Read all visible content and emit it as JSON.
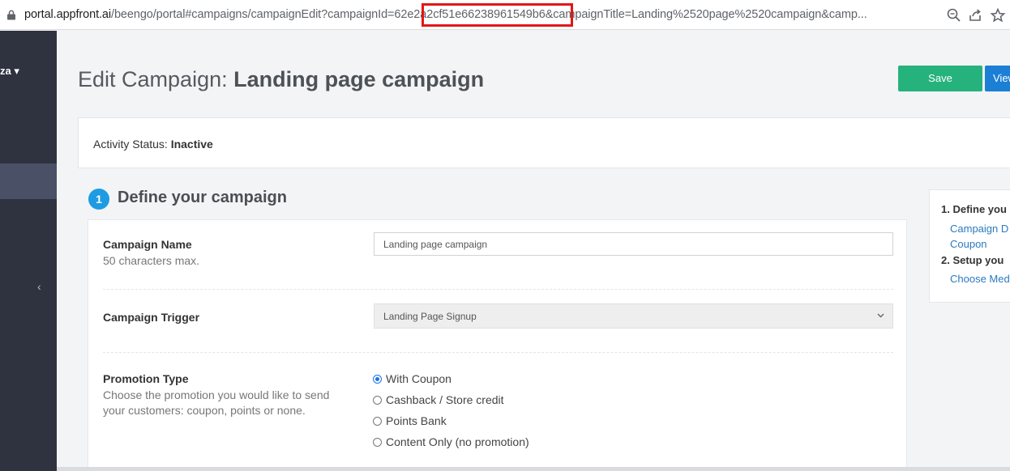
{
  "browser": {
    "url_host": "portal.appfront.ai",
    "url_rest": "/beengo/portal#campaigns/campaignEdit?campaignId=62e2a2cf51e66238961549b6&campaignTitle=Landing%2520page%2520campaign&camp..."
  },
  "sidebar": {
    "user_label": "za ▾",
    "collapse_icon": "‹"
  },
  "header": {
    "title_prefix": "Edit Campaign:",
    "title_name": "Landing page campaign",
    "save_label": "Save",
    "view_label": "View"
  },
  "status": {
    "label": "Activity Status:",
    "value": "Inactive"
  },
  "section": {
    "number": "1",
    "title": "Define your campaign"
  },
  "form": {
    "campaign_name": {
      "label": "Campaign Name",
      "hint": "50 characters max.",
      "value": "Landing page campaign"
    },
    "campaign_trigger": {
      "label": "Campaign Trigger",
      "selected": "Landing Page Signup"
    },
    "promotion_type": {
      "label": "Promotion Type",
      "hint": "Choose the promotion you would like to send your customers: coupon, points or none.",
      "options": [
        "With Coupon",
        "Cashback / Store credit",
        "Points Bank",
        "Content Only (no promotion)"
      ],
      "selected_index": 0
    }
  },
  "toc": {
    "items": [
      {
        "type": "section",
        "text": "1. Define you"
      },
      {
        "type": "link",
        "text": "Campaign D"
      },
      {
        "type": "link",
        "text": "Coupon"
      },
      {
        "type": "section",
        "text": "2. Setup you"
      },
      {
        "type": "link",
        "text": "Choose Med"
      }
    ]
  },
  "colors": {
    "save": "#26b27c",
    "view": "#1b7fd6",
    "badge": "#1e9be2",
    "sidebar": "#2f3340",
    "highlight": "#e01717"
  },
  "icons": [
    "lock-icon",
    "zoom-icon",
    "share-icon",
    "star-icon",
    "chevron-down-icon",
    "radio-checked-icon",
    "radio-unchecked-icon",
    "collapse-chevron-icon"
  ]
}
